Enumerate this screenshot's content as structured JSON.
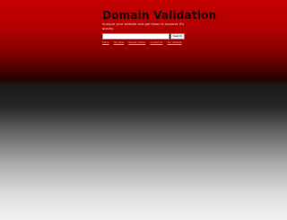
{
  "header": {
    "title": "Domain Validation",
    "tagline": "Analyze your website and get ideas to improve it's quality."
  },
  "search": {
    "value": "",
    "placeholder": "",
    "button_label": "Search"
  },
  "nav": {
    "links": [
      "Home",
      "Top Sites",
      "Recent Checks",
      "Contact Us",
      "Our Website"
    ]
  }
}
